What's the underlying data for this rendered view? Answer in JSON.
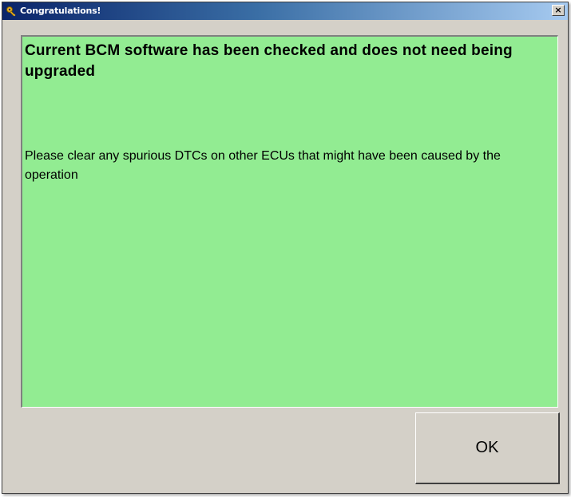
{
  "window": {
    "title": "Congratulations!",
    "title_icon": "key-icon",
    "close_label": "×"
  },
  "message": {
    "heading": "Current BCM software has been checked and does not need being upgraded",
    "body": "Please clear any spurious DTCs on other ECUs that might have been caused by the operation",
    "background_color": "#92ec92"
  },
  "buttons": {
    "ok_label": "OK"
  }
}
